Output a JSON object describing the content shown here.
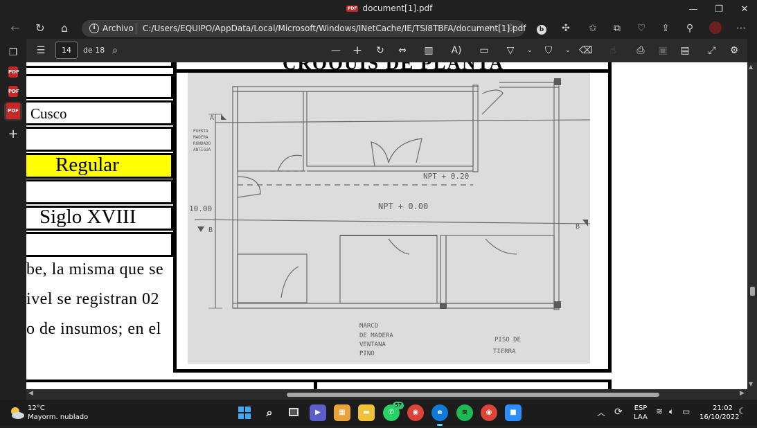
{
  "window": {
    "title": "document[1].pdf",
    "minimize": "—",
    "maximize": "❐",
    "close": "✕"
  },
  "address": {
    "site_label": "Archivo",
    "url": "C:/Users/EQUIPO/AppData/Local/Microsoft/Windows/INetCache/IE/TSI8TBFA/document[1].pdf"
  },
  "pdf_toolbar": {
    "page_number": "14",
    "page_total": "de 18"
  },
  "document": {
    "heading_partial": "CROQUIS DE PLANTA",
    "cells": [
      {
        "text": ""
      },
      {
        "text": "Cusco"
      },
      {
        "text": ""
      },
      {
        "text": "Regular"
      },
      {
        "text": ""
      },
      {
        "text": "Siglo XVIII"
      },
      {
        "text": ""
      }
    ],
    "paragraph_lines": [
      "be, la misma que se",
      "ivel se registran 02",
      "o de insumos; en el"
    ],
    "sketch": {
      "label_a": "A",
      "label_b_left": "B",
      "label_b_right": "B",
      "puerta": [
        "PUERTA",
        "MADERA",
        "RONDADO",
        "ANTIGUA"
      ],
      "npt_020": "NPT + 0.20",
      "npt_000": "NPT + 0.00",
      "dim": "10.00",
      "marco": [
        "MARCO",
        "DE MADERA",
        "VENTANA",
        "PINO"
      ],
      "piso": [
        "PISO  DE",
        "TIERRA"
      ]
    },
    "highlight_color": "#ffff00"
  },
  "taskbar": {
    "weather_temp": "12°C",
    "weather_desc": "Mayorm. nublado",
    "lang_1": "ESP",
    "lang_2": "LAA",
    "time": "21:02",
    "date": "16/10/2022",
    "whatsapp_badge": "57"
  }
}
